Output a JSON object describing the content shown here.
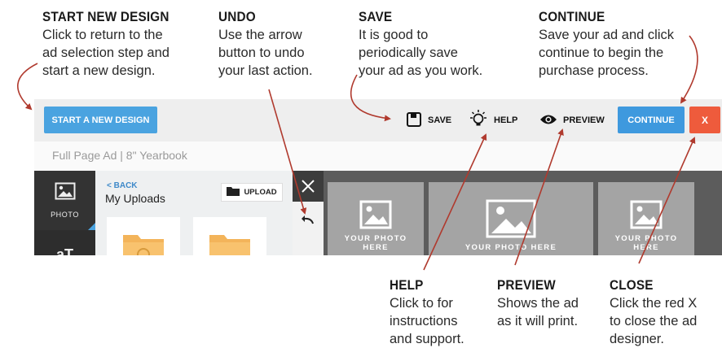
{
  "callouts": {
    "start_new": {
      "title": "START NEW DESIGN",
      "lines": [
        "Click to return to the",
        "ad selection step and",
        "start a new design."
      ]
    },
    "undo": {
      "title": "UNDO",
      "lines": [
        "Use the arrow",
        "button to undo",
        "your last action."
      ]
    },
    "save": {
      "title": "SAVE",
      "lines": [
        "It is good to",
        "periodically save",
        "your ad as you work."
      ]
    },
    "continue": {
      "title": "CONTINUE",
      "lines": [
        "Save your ad and click",
        "continue to begin the",
        "purchase process."
      ]
    },
    "help": {
      "title": "HELP",
      "lines": [
        "Click to for",
        "instructions",
        "and support."
      ]
    },
    "preview": {
      "title": "PREVIEW",
      "lines": [
        "Shows the ad",
        "as it will print."
      ]
    },
    "close": {
      "title": "CLOSE",
      "lines": [
        "Click the red X",
        "to close the ad",
        "designer."
      ]
    }
  },
  "toolbar": {
    "start_new_label": "START A NEW DESIGN",
    "save_label": "SAVE",
    "help_label": "HELP",
    "preview_label": "PREVIEW",
    "continue_label": "CONTINUE",
    "close_label": "X"
  },
  "doc_title": "Full Page Ad | 8\" Yearbook",
  "sidebar": {
    "photo_label": "PHOTO",
    "text_label": "aT"
  },
  "panel": {
    "back_label": "BACK",
    "title": "My Uploads",
    "upload_label": "UPLOAD"
  },
  "photo_slots": [
    {
      "line1": "YOUR PHOTO",
      "line2": "HERE"
    },
    {
      "line1": "YOUR PHOTO HERE",
      "line2": ""
    },
    {
      "line1": "YOUR PHOTO",
      "line2": "HERE"
    }
  ],
  "colors": {
    "accent": "#4aa3e0",
    "close": "#ee5b3c",
    "arrow": "#b03a2e"
  },
  "icons": [
    "save-icon",
    "lightbulb-icon",
    "eye-icon",
    "folder-icon",
    "undo-icon",
    "close-icon",
    "image-icon",
    "chevron-left-icon"
  ]
}
